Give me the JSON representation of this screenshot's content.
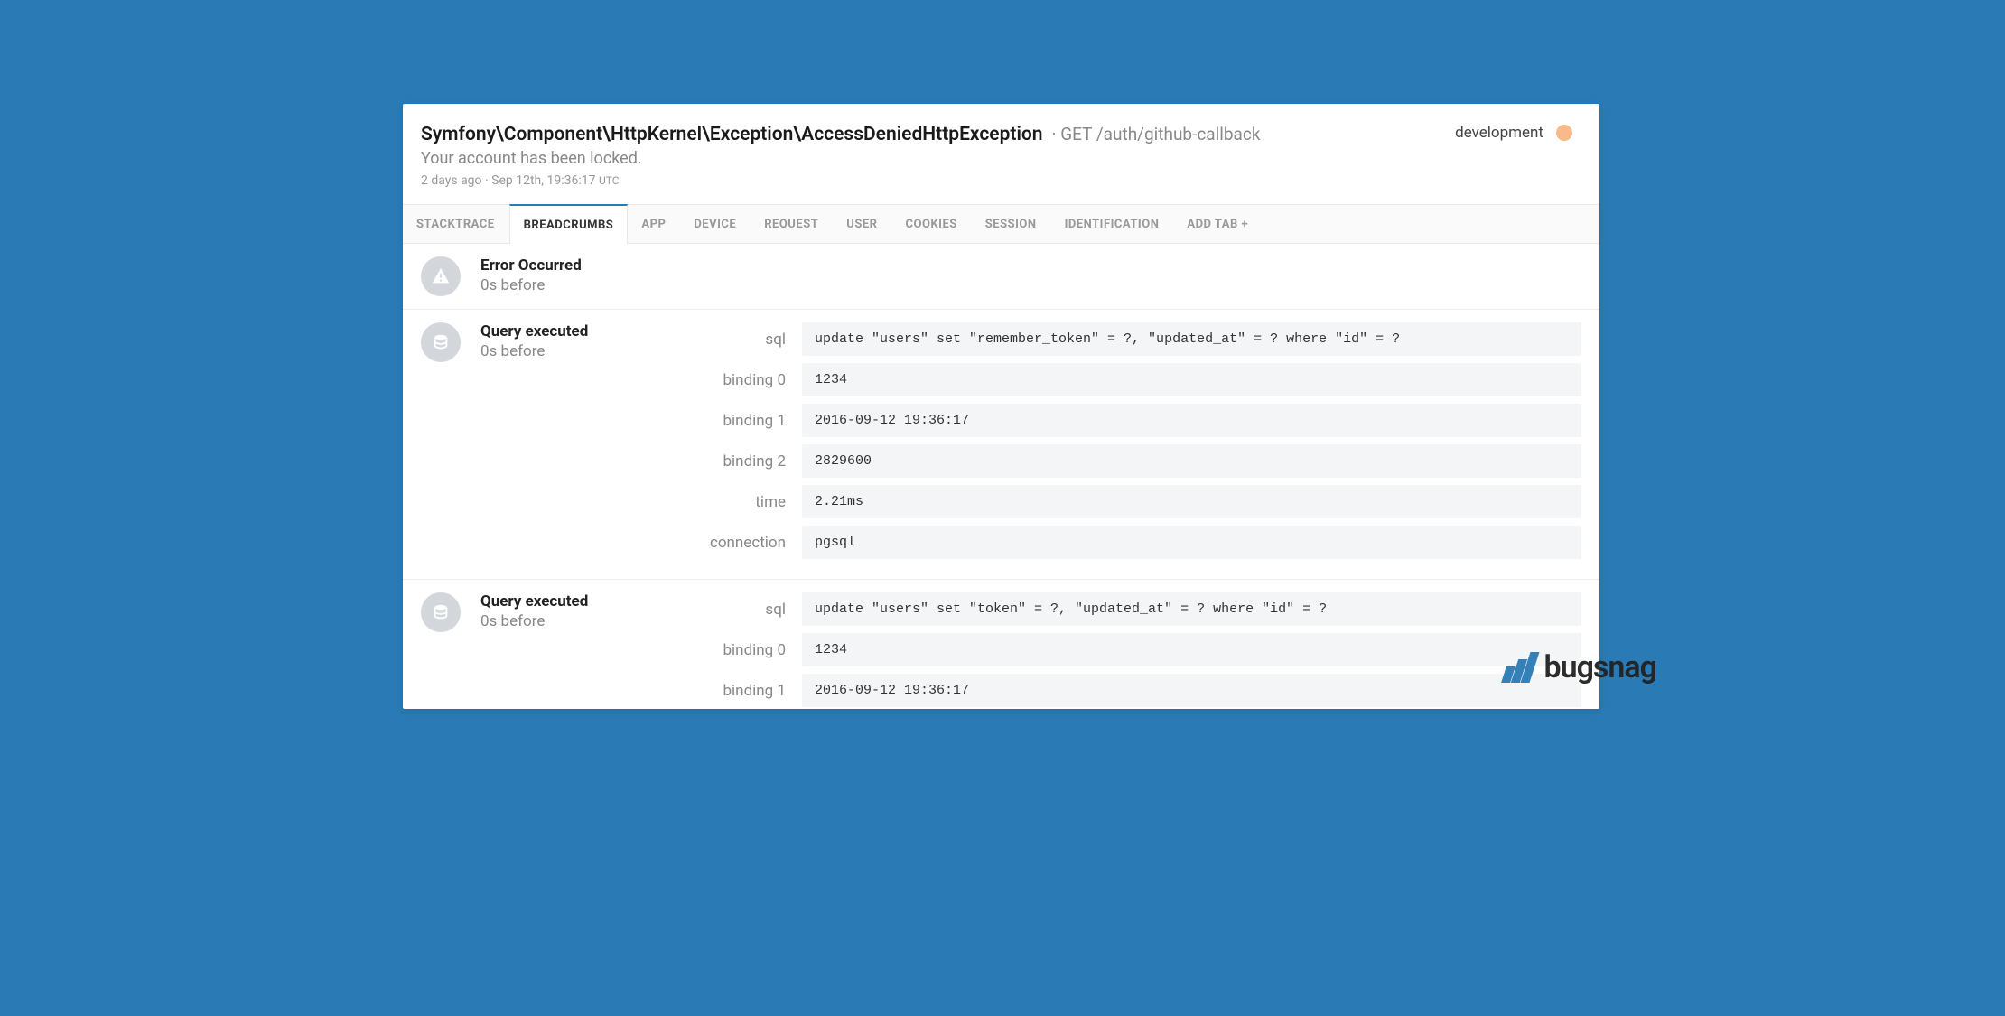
{
  "header": {
    "exception": "Symfony\\Component\\HttpKernel\\Exception\\AccessDeniedHttpException",
    "method_path": "GET /auth/github-callback",
    "message": "Your account has been locked.",
    "relative_time": "2 days ago",
    "timestamp": "Sep 12th, 19:36:17",
    "timezone": "UTC",
    "environment": "development"
  },
  "tabs": [
    {
      "label": "STACKTRACE",
      "active": false
    },
    {
      "label": "BREADCRUMBS",
      "active": true
    },
    {
      "label": "APP",
      "active": false
    },
    {
      "label": "DEVICE",
      "active": false
    },
    {
      "label": "REQUEST",
      "active": false
    },
    {
      "label": "USER",
      "active": false
    },
    {
      "label": "COOKIES",
      "active": false
    },
    {
      "label": "SESSION",
      "active": false
    },
    {
      "label": "IDENTIFICATION",
      "active": false
    },
    {
      "label": "ADD TAB +",
      "active": false
    }
  ],
  "breadcrumbs": [
    {
      "icon": "warning",
      "title": "Error Occurred",
      "time": "0s before",
      "details": []
    },
    {
      "icon": "database",
      "title": "Query executed",
      "time": "0s before",
      "details": [
        {
          "label": "sql",
          "value": "update \"users\" set \"remember_token\" = ?, \"updated_at\" = ? where \"id\" = ?"
        },
        {
          "label": "binding 0",
          "value": "1234"
        },
        {
          "label": "binding 1",
          "value": "2016-09-12 19:36:17"
        },
        {
          "label": "binding 2",
          "value": "2829600"
        },
        {
          "label": "time",
          "value": "2.21ms"
        },
        {
          "label": "connection",
          "value": "pgsql"
        }
      ]
    },
    {
      "icon": "database",
      "title": "Query executed",
      "time": "0s before",
      "details": [
        {
          "label": "sql",
          "value": "update \"users\" set \"token\" = ?, \"updated_at\" = ? where \"id\" = ?"
        },
        {
          "label": "binding 0",
          "value": "1234"
        },
        {
          "label": "binding 1",
          "value": "2016-09-12 19:36:17"
        }
      ]
    }
  ],
  "watermark": "bugsnag"
}
